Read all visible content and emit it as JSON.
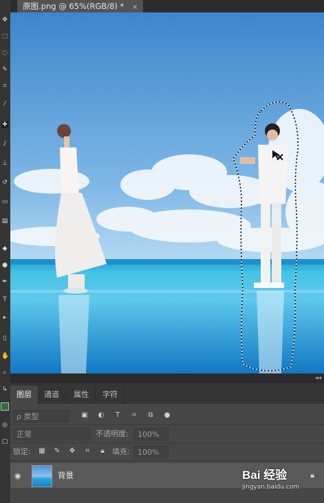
{
  "document": {
    "tab_title": "原图.png @ 65%(RGB/8) *",
    "close_glyph": "×"
  },
  "panel": {
    "tabs": [
      {
        "label": "图层",
        "active": true
      },
      {
        "label": "通道",
        "active": false
      },
      {
        "label": "属性",
        "active": false
      },
      {
        "label": "字符",
        "active": false
      }
    ],
    "filter": {
      "kind_label": "ρ 类型"
    },
    "blend": {
      "mode": "正常",
      "opacity_label": "不透明度:",
      "opacity_value": "100%"
    },
    "lock": {
      "label": "锁定:",
      "fill_label": "填充:",
      "fill_value": "100%"
    },
    "layers": [
      {
        "name": "背景",
        "visible": true,
        "locked": true
      }
    ]
  },
  "watermark": {
    "logo": "Bai 经验",
    "url": "jingyan.baidu.com"
  },
  "colors": {
    "sky": "#4f94d4",
    "sea": "#1ea3d6",
    "panel_bg": "#474747",
    "selection": "#0b1220"
  }
}
